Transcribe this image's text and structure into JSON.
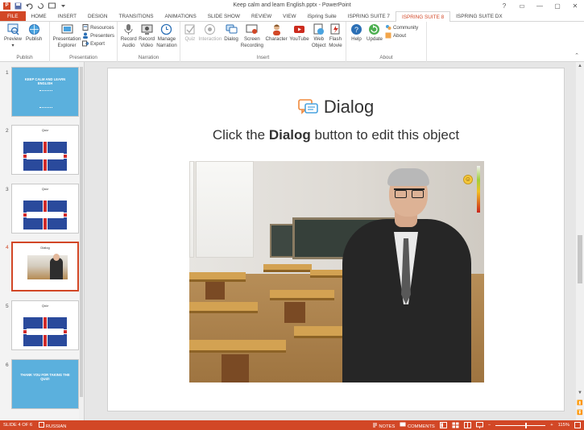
{
  "window": {
    "title": "Keep calm and learn English.pptx - PowerPoint",
    "controls": [
      "?",
      "▭",
      "—",
      "▢",
      "✕"
    ]
  },
  "tabs": [
    "FILE",
    "HOME",
    "INSERT",
    "DESIGN",
    "TRANSITIONS",
    "ANIMATIONS",
    "SLIDE SHOW",
    "REVIEW",
    "VIEW",
    "iSpring Suite",
    "ISPRING SUITE 7",
    "ISPRING SUITE 8",
    "ISPRING SUITE DX"
  ],
  "active_tab_index": 11,
  "ribbon": {
    "publish": {
      "label": "Publish",
      "preview": "Preview",
      "publish": "Publish"
    },
    "presentation": {
      "label": "Presentation",
      "explorer": "Presentation\nExplorer",
      "resources": "Resources",
      "presenters": "Presenters",
      "export": "Export"
    },
    "narration": {
      "label": "Narration",
      "record_audio": "Record\nAudio",
      "record_video": "Record\nVideo",
      "manage": "Manage\nNarration"
    },
    "insert": {
      "label": "Insert",
      "quiz": "Quiz",
      "interaction": "Interaction",
      "dialog": "Dialog",
      "screen": "Screen\nRecording",
      "character": "Character",
      "youtube": "YouTube",
      "web": "Web\nObject",
      "flash": "Flash\nMovie"
    },
    "about": {
      "label": "About",
      "help": "Help",
      "update": "Update",
      "community": "Community",
      "about": "About"
    }
  },
  "thumbnails": [
    {
      "num": "1",
      "title": "KEEP CALM AND LEARN ENGLISH"
    },
    {
      "num": "2",
      "label": "Quiz"
    },
    {
      "num": "3",
      "label": "Quiz"
    },
    {
      "num": "4",
      "label": "Dialog"
    },
    {
      "num": "5",
      "label": "Quiz"
    },
    {
      "num": "6",
      "text": "THANK YOU FOR TAKING THE QUIZ!"
    }
  ],
  "selected_slide": 4,
  "slide": {
    "title": "Dialog",
    "sub_pre": "Click the ",
    "sub_bold": "Dialog",
    "sub_post": " button to edit this object"
  },
  "status": {
    "slide": "SLIDE 4 OF 6",
    "language": "RUSSIAN",
    "notes": "NOTES",
    "comments": "COMMENTS",
    "zoom": "115%"
  },
  "colors": {
    "accent": "#d24726",
    "ispring_blue": "#2b6fb5"
  }
}
